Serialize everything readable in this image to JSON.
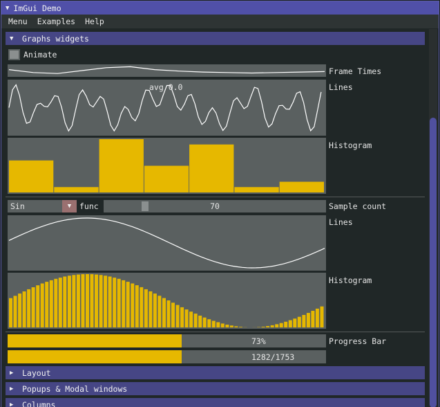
{
  "window": {
    "title": "ImGui Demo"
  },
  "menubar": {
    "items": [
      "Menu",
      "Examples",
      "Help"
    ]
  },
  "sections": {
    "graphs": "Graphs widgets",
    "layout": "Layout",
    "popups": "Popups & Modal windows",
    "columns": "Columns"
  },
  "animate": {
    "label": "Animate",
    "checked": false
  },
  "frame_times": {
    "label": "Frame Times",
    "values": [
      0.6,
      0.3,
      0.2,
      0.5,
      0.8,
      0.9,
      0.6,
      0.45,
      0.35,
      0.3,
      0.25,
      0.3,
      0.35,
      0.4
    ]
  },
  "lines1": {
    "label": "Lines",
    "overlay": "avg 0.0"
  },
  "histogram1": {
    "label": "Histogram",
    "values": [
      0.6,
      0.1,
      1.0,
      0.5,
      0.9,
      0.1,
      0.2
    ]
  },
  "func_combo": {
    "value": "Sin",
    "label": "func"
  },
  "sample_count": {
    "label": "Sample count",
    "value": 70,
    "min": 1,
    "max": 400
  },
  "lines2": {
    "label": "Lines"
  },
  "histogram2": {
    "label": "Histogram"
  },
  "progress": {
    "label": "Progress Bar",
    "fraction": 0.73,
    "text1": "73%",
    "text2": "1282/1753",
    "count": 1282,
    "total": 1753
  },
  "colors": {
    "accent": "#e6b800",
    "header": "#464685",
    "title": "#5050a8",
    "line": "#ffffff"
  }
}
